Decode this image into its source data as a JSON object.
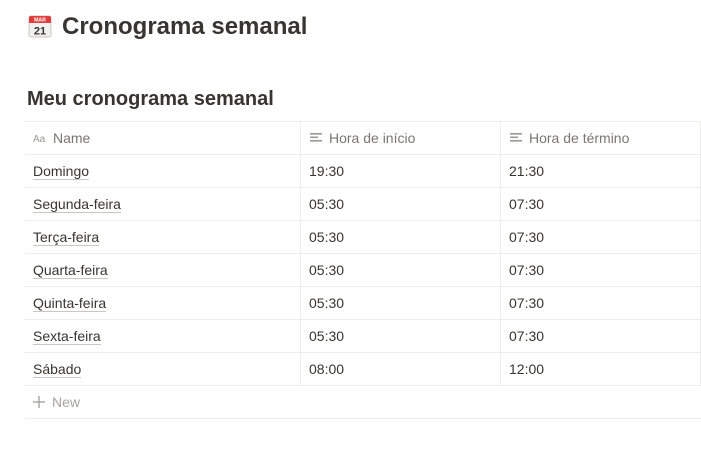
{
  "page": {
    "title": "Cronograma semanal",
    "icon": "calendar-icon",
    "icon_month": "MAR",
    "icon_day": "21"
  },
  "database": {
    "title": "Meu cronograma semanal",
    "columns": [
      {
        "label": "Name",
        "icon": "title-property-icon"
      },
      {
        "label": "Hora de início",
        "icon": "text-property-icon"
      },
      {
        "label": "Hora de término",
        "icon": "text-property-icon"
      }
    ],
    "rows": [
      {
        "name": "Domingo",
        "start": "19:30",
        "end": "21:30"
      },
      {
        "name": "Segunda-feira",
        "start": "05:30",
        "end": "07:30"
      },
      {
        "name": "Terça-feira",
        "start": "05:30",
        "end": "07:30"
      },
      {
        "name": "Quarta-feira",
        "start": "05:30",
        "end": "07:30"
      },
      {
        "name": "Quinta-feira",
        "start": "05:30",
        "end": "07:30"
      },
      {
        "name": "Sexta-feira",
        "start": "05:30",
        "end": "07:30"
      },
      {
        "name": "Sábado",
        "start": "08:00",
        "end": "12:00"
      }
    ],
    "new_label": "New"
  },
  "colors": {
    "text": "#37352f",
    "muted": "#787774",
    "border": "#ededec",
    "calendar_red": "#e03e3e"
  }
}
